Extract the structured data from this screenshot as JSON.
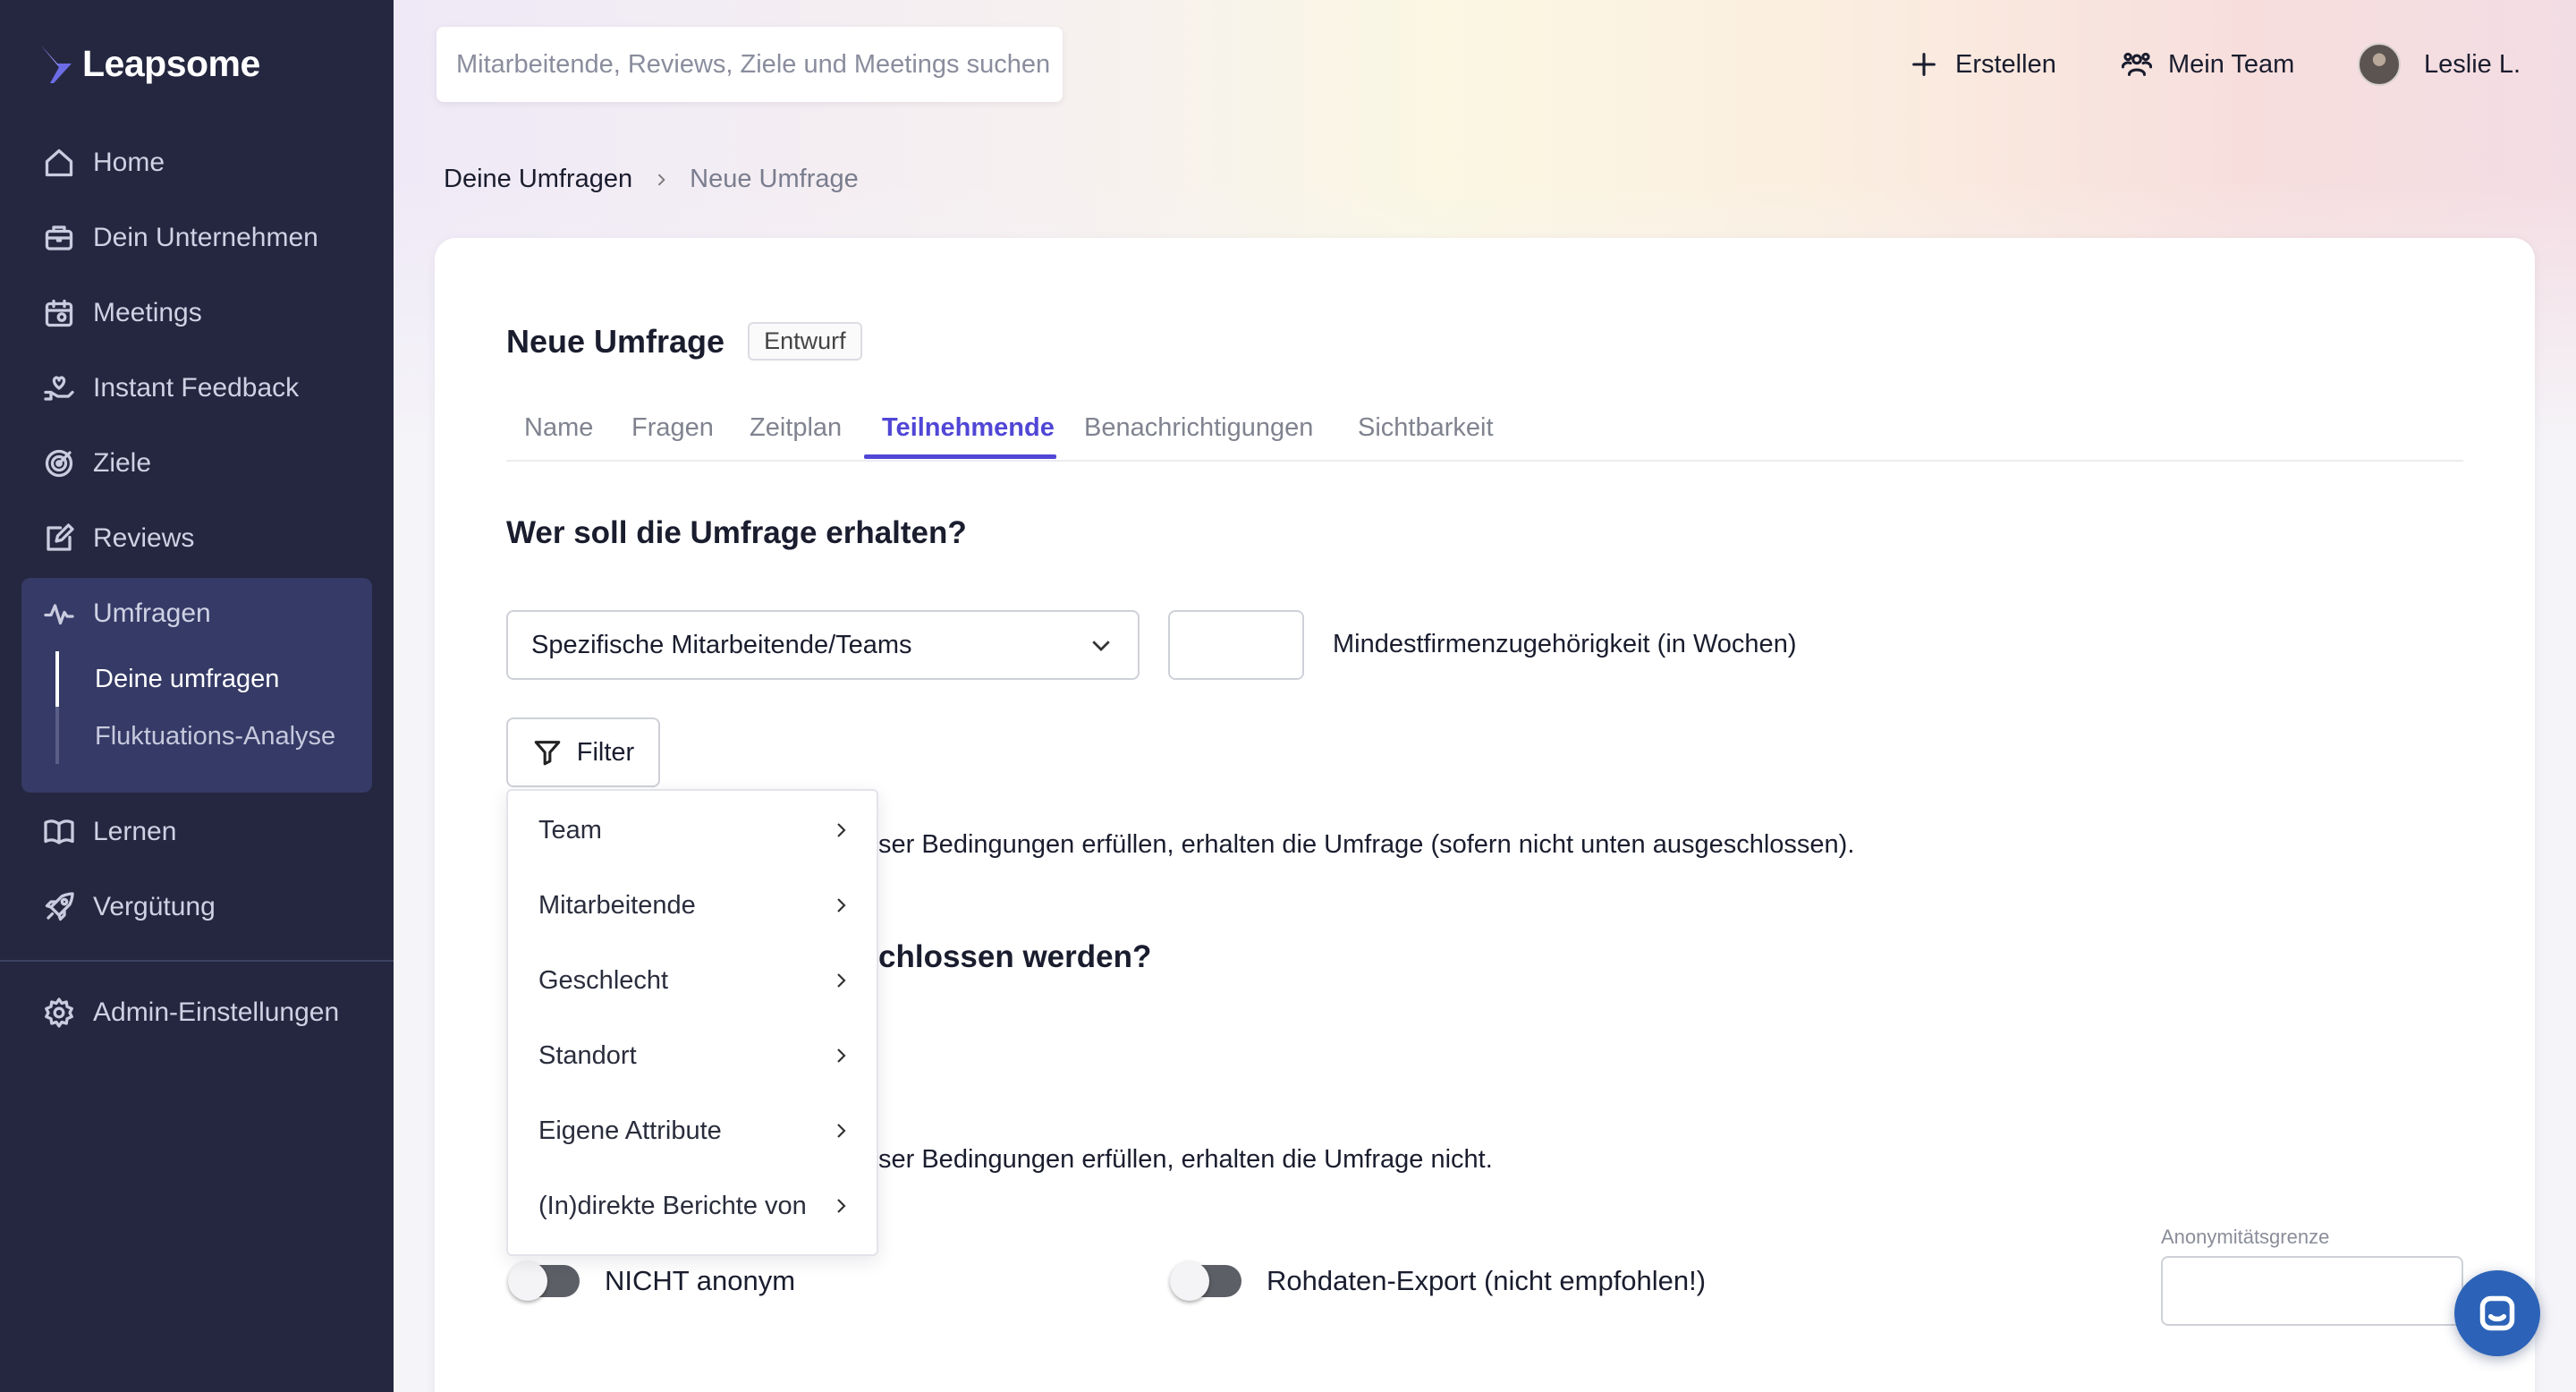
{
  "app": {
    "name": "Leapsome",
    "brand_color": "#24273f",
    "accent_color": "#5046d6"
  },
  "sidebar": {
    "items": [
      {
        "label": "Home",
        "icon": "home-icon"
      },
      {
        "label": "Dein Unternehmen",
        "icon": "building-icon"
      },
      {
        "label": "Meetings",
        "icon": "calendar-icon"
      },
      {
        "label": "Instant Feedback",
        "icon": "hand-heart-icon"
      },
      {
        "label": "Ziele",
        "icon": "target-icon"
      },
      {
        "label": "Reviews",
        "icon": "edit-icon"
      },
      {
        "label": "Umfragen",
        "icon": "pulse-icon"
      },
      {
        "label": "Lernen",
        "icon": "book-icon"
      },
      {
        "label": "Vergütung",
        "icon": "rocket-icon"
      },
      {
        "label": "Admin-Einstellungen",
        "icon": "gear-icon"
      }
    ],
    "umfragen_sub": [
      {
        "label": "Deine umfragen",
        "active": true
      },
      {
        "label": "Fluktuations-Analyse",
        "active": false
      }
    ]
  },
  "header": {
    "search_placeholder": "Mitarbeitende, Reviews, Ziele und Meetings suchen",
    "create_label": "Erstellen",
    "team_label": "Mein Team",
    "user_label": "Leslie L."
  },
  "breadcrumb": {
    "parent": "Deine Umfragen",
    "current": "Neue Umfrage"
  },
  "page": {
    "title": "Neue Umfrage",
    "status_badge": "Entwurf",
    "tabs": [
      {
        "label": "Name",
        "active": false
      },
      {
        "label": "Fragen",
        "active": false
      },
      {
        "label": "Zeitplan",
        "active": false
      },
      {
        "label": "Teilnehmende",
        "active": true
      },
      {
        "label": "Benachrichtigungen",
        "active": false
      },
      {
        "label": "Sichtbarkeit",
        "active": false
      }
    ]
  },
  "participants": {
    "heading": "Wer soll die Umfrage erhalten?",
    "select_value": "Spezifische Mitarbeitende/Teams",
    "min_tenure_value": "",
    "min_tenure_label": "Mindestfirmenzugehörigkeit (in Wochen)",
    "filter_label": "Filter",
    "include_text_partial": "ser Bedingungen erfüllen, erhalten die Umfrage (sofern nicht unten ausgeschlossen).",
    "exclude_heading_partial": "chlossen werden?",
    "exclude_text_partial": "ser Bedingungen erfüllen, erhalten die Umfrage nicht."
  },
  "filter_menu": {
    "items": [
      "Team",
      "Mitarbeitende",
      "Geschlecht",
      "Standort",
      "Eigene Attribute",
      "(In)direkte Berichte von"
    ]
  },
  "options": {
    "not_anonymous_label": "NICHT anonym",
    "not_anonymous_on": false,
    "raw_export_label": "Rohdaten-Export (nicht empfohlen!)",
    "raw_export_on": false,
    "anonymity_threshold_label": "Anonymitätsgrenze",
    "anonymity_threshold_value": ""
  }
}
